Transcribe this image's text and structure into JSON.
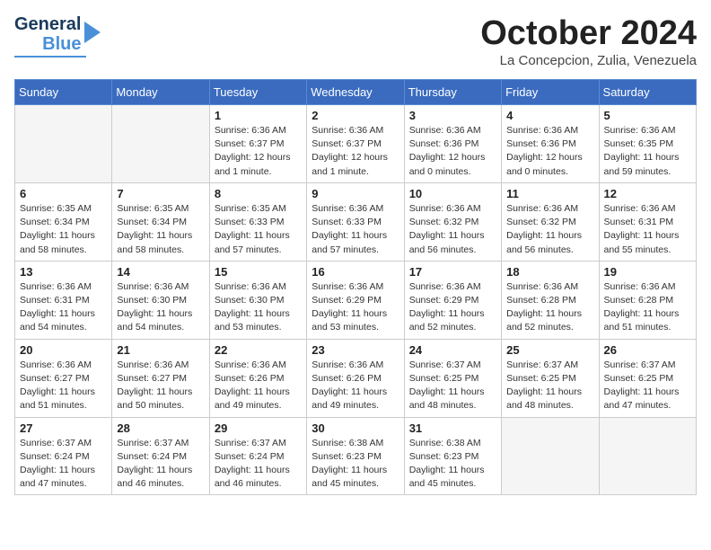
{
  "header": {
    "logo_line1": "General",
    "logo_line2": "Blue",
    "month_title": "October 2024",
    "subtitle": "La Concepcion, Zulia, Venezuela"
  },
  "weekdays": [
    "Sunday",
    "Monday",
    "Tuesday",
    "Wednesday",
    "Thursday",
    "Friday",
    "Saturday"
  ],
  "weeks": [
    [
      {
        "day": "",
        "info": ""
      },
      {
        "day": "",
        "info": ""
      },
      {
        "day": "1",
        "info": "Sunrise: 6:36 AM\nSunset: 6:37 PM\nDaylight: 12 hours and 1 minute."
      },
      {
        "day": "2",
        "info": "Sunrise: 6:36 AM\nSunset: 6:37 PM\nDaylight: 12 hours and 1 minute."
      },
      {
        "day": "3",
        "info": "Sunrise: 6:36 AM\nSunset: 6:36 PM\nDaylight: 12 hours and 0 minutes."
      },
      {
        "day": "4",
        "info": "Sunrise: 6:36 AM\nSunset: 6:36 PM\nDaylight: 12 hours and 0 minutes."
      },
      {
        "day": "5",
        "info": "Sunrise: 6:36 AM\nSunset: 6:35 PM\nDaylight: 11 hours and 59 minutes."
      }
    ],
    [
      {
        "day": "6",
        "info": "Sunrise: 6:35 AM\nSunset: 6:34 PM\nDaylight: 11 hours and 58 minutes."
      },
      {
        "day": "7",
        "info": "Sunrise: 6:35 AM\nSunset: 6:34 PM\nDaylight: 11 hours and 58 minutes."
      },
      {
        "day": "8",
        "info": "Sunrise: 6:35 AM\nSunset: 6:33 PM\nDaylight: 11 hours and 57 minutes."
      },
      {
        "day": "9",
        "info": "Sunrise: 6:36 AM\nSunset: 6:33 PM\nDaylight: 11 hours and 57 minutes."
      },
      {
        "day": "10",
        "info": "Sunrise: 6:36 AM\nSunset: 6:32 PM\nDaylight: 11 hours and 56 minutes."
      },
      {
        "day": "11",
        "info": "Sunrise: 6:36 AM\nSunset: 6:32 PM\nDaylight: 11 hours and 56 minutes."
      },
      {
        "day": "12",
        "info": "Sunrise: 6:36 AM\nSunset: 6:31 PM\nDaylight: 11 hours and 55 minutes."
      }
    ],
    [
      {
        "day": "13",
        "info": "Sunrise: 6:36 AM\nSunset: 6:31 PM\nDaylight: 11 hours and 54 minutes."
      },
      {
        "day": "14",
        "info": "Sunrise: 6:36 AM\nSunset: 6:30 PM\nDaylight: 11 hours and 54 minutes."
      },
      {
        "day": "15",
        "info": "Sunrise: 6:36 AM\nSunset: 6:30 PM\nDaylight: 11 hours and 53 minutes."
      },
      {
        "day": "16",
        "info": "Sunrise: 6:36 AM\nSunset: 6:29 PM\nDaylight: 11 hours and 53 minutes."
      },
      {
        "day": "17",
        "info": "Sunrise: 6:36 AM\nSunset: 6:29 PM\nDaylight: 11 hours and 52 minutes."
      },
      {
        "day": "18",
        "info": "Sunrise: 6:36 AM\nSunset: 6:28 PM\nDaylight: 11 hours and 52 minutes."
      },
      {
        "day": "19",
        "info": "Sunrise: 6:36 AM\nSunset: 6:28 PM\nDaylight: 11 hours and 51 minutes."
      }
    ],
    [
      {
        "day": "20",
        "info": "Sunrise: 6:36 AM\nSunset: 6:27 PM\nDaylight: 11 hours and 51 minutes."
      },
      {
        "day": "21",
        "info": "Sunrise: 6:36 AM\nSunset: 6:27 PM\nDaylight: 11 hours and 50 minutes."
      },
      {
        "day": "22",
        "info": "Sunrise: 6:36 AM\nSunset: 6:26 PM\nDaylight: 11 hours and 49 minutes."
      },
      {
        "day": "23",
        "info": "Sunrise: 6:36 AM\nSunset: 6:26 PM\nDaylight: 11 hours and 49 minutes."
      },
      {
        "day": "24",
        "info": "Sunrise: 6:37 AM\nSunset: 6:25 PM\nDaylight: 11 hours and 48 minutes."
      },
      {
        "day": "25",
        "info": "Sunrise: 6:37 AM\nSunset: 6:25 PM\nDaylight: 11 hours and 48 minutes."
      },
      {
        "day": "26",
        "info": "Sunrise: 6:37 AM\nSunset: 6:25 PM\nDaylight: 11 hours and 47 minutes."
      }
    ],
    [
      {
        "day": "27",
        "info": "Sunrise: 6:37 AM\nSunset: 6:24 PM\nDaylight: 11 hours and 47 minutes."
      },
      {
        "day": "28",
        "info": "Sunrise: 6:37 AM\nSunset: 6:24 PM\nDaylight: 11 hours and 46 minutes."
      },
      {
        "day": "29",
        "info": "Sunrise: 6:37 AM\nSunset: 6:24 PM\nDaylight: 11 hours and 46 minutes."
      },
      {
        "day": "30",
        "info": "Sunrise: 6:38 AM\nSunset: 6:23 PM\nDaylight: 11 hours and 45 minutes."
      },
      {
        "day": "31",
        "info": "Sunrise: 6:38 AM\nSunset: 6:23 PM\nDaylight: 11 hours and 45 minutes."
      },
      {
        "day": "",
        "info": ""
      },
      {
        "day": "",
        "info": ""
      }
    ]
  ]
}
